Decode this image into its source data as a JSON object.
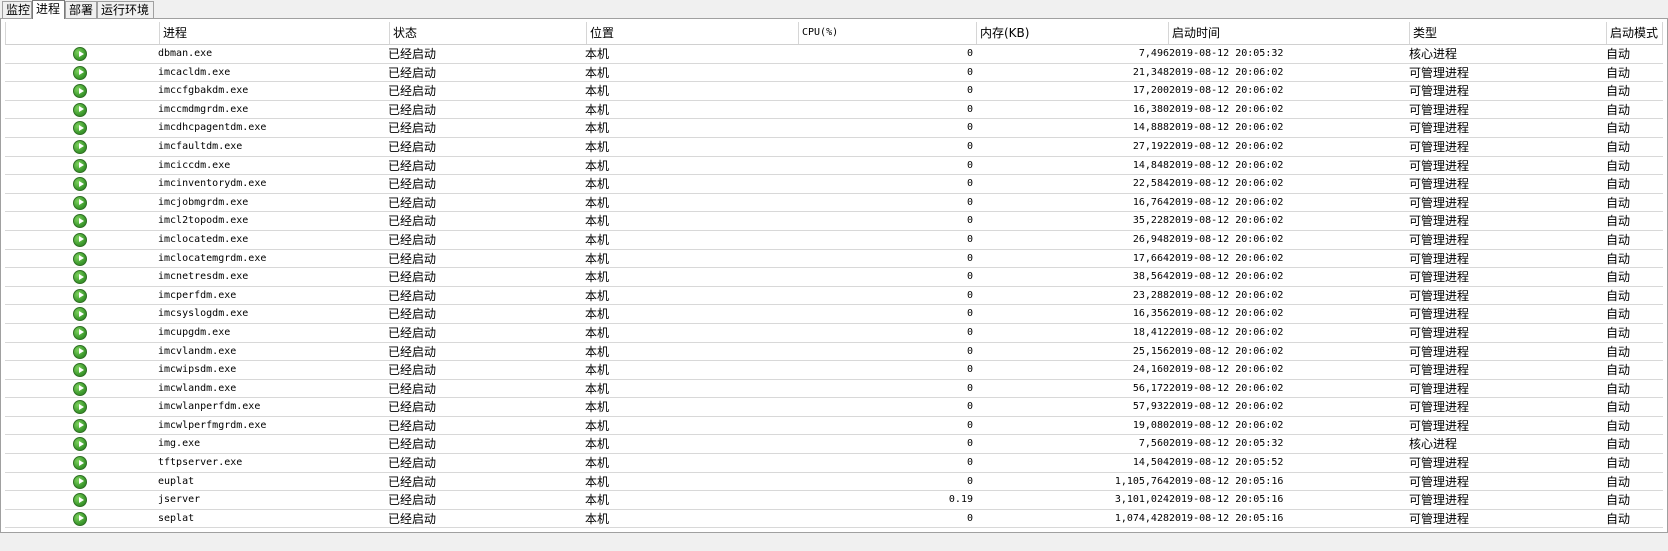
{
  "tabs": [
    "监控",
    "进程",
    "部署",
    "运行环境"
  ],
  "active_tab": "进程",
  "columns": [
    "进程",
    "状态",
    "位置",
    "CPU(%)",
    "内存(KB)",
    "启动时间",
    "类型",
    "启动模式"
  ],
  "rows": [
    {
      "icon": "running-icon",
      "name": "dbman.exe",
      "status": "已经启动",
      "location": "本机",
      "cpu": "0",
      "memory": "7,496",
      "start": "2019-08-12 20:05:32",
      "type": "核心进程",
      "mode": "自动"
    },
    {
      "icon": "running-icon",
      "name": "imcacldm.exe",
      "status": "已经启动",
      "location": "本机",
      "cpu": "0",
      "memory": "21,348",
      "start": "2019-08-12 20:06:02",
      "type": "可管理进程",
      "mode": "自动"
    },
    {
      "icon": "running-icon",
      "name": "imccfgbakdm.exe",
      "status": "已经启动",
      "location": "本机",
      "cpu": "0",
      "memory": "17,200",
      "start": "2019-08-12 20:06:02",
      "type": "可管理进程",
      "mode": "自动"
    },
    {
      "icon": "running-icon",
      "name": "imccmdmgrdm.exe",
      "status": "已经启动",
      "location": "本机",
      "cpu": "0",
      "memory": "16,380",
      "start": "2019-08-12 20:06:02",
      "type": "可管理进程",
      "mode": "自动"
    },
    {
      "icon": "running-icon",
      "name": "imcdhcpagentdm.exe",
      "status": "已经启动",
      "location": "本机",
      "cpu": "0",
      "memory": "14,888",
      "start": "2019-08-12 20:06:02",
      "type": "可管理进程",
      "mode": "自动"
    },
    {
      "icon": "running-icon",
      "name": "imcfaultdm.exe",
      "status": "已经启动",
      "location": "本机",
      "cpu": "0",
      "memory": "27,192",
      "start": "2019-08-12 20:06:02",
      "type": "可管理进程",
      "mode": "自动"
    },
    {
      "icon": "running-icon",
      "name": "imciccdm.exe",
      "status": "已经启动",
      "location": "本机",
      "cpu": "0",
      "memory": "14,848",
      "start": "2019-08-12 20:06:02",
      "type": "可管理进程",
      "mode": "自动"
    },
    {
      "icon": "running-icon",
      "name": "imcinventorydm.exe",
      "status": "已经启动",
      "location": "本机",
      "cpu": "0",
      "memory": "22,584",
      "start": "2019-08-12 20:06:02",
      "type": "可管理进程",
      "mode": "自动"
    },
    {
      "icon": "running-icon",
      "name": "imcjobmgrdm.exe",
      "status": "已经启动",
      "location": "本机",
      "cpu": "0",
      "memory": "16,764",
      "start": "2019-08-12 20:06:02",
      "type": "可管理进程",
      "mode": "自动"
    },
    {
      "icon": "running-icon",
      "name": "imcl2topodm.exe",
      "status": "已经启动",
      "location": "本机",
      "cpu": "0",
      "memory": "35,228",
      "start": "2019-08-12 20:06:02",
      "type": "可管理进程",
      "mode": "自动"
    },
    {
      "icon": "running-icon",
      "name": "imclocatedm.exe",
      "status": "已经启动",
      "location": "本机",
      "cpu": "0",
      "memory": "26,948",
      "start": "2019-08-12 20:06:02",
      "type": "可管理进程",
      "mode": "自动"
    },
    {
      "icon": "running-icon",
      "name": "imclocatemgrdm.exe",
      "status": "已经启动",
      "location": "本机",
      "cpu": "0",
      "memory": "17,664",
      "start": "2019-08-12 20:06:02",
      "type": "可管理进程",
      "mode": "自动"
    },
    {
      "icon": "running-icon",
      "name": "imcnetresdm.exe",
      "status": "已经启动",
      "location": "本机",
      "cpu": "0",
      "memory": "38,564",
      "start": "2019-08-12 20:06:02",
      "type": "可管理进程",
      "mode": "自动"
    },
    {
      "icon": "running-icon",
      "name": "imcperfdm.exe",
      "status": "已经启动",
      "location": "本机",
      "cpu": "0",
      "memory": "23,288",
      "start": "2019-08-12 20:06:02",
      "type": "可管理进程",
      "mode": "自动"
    },
    {
      "icon": "running-icon",
      "name": "imcsyslogdm.exe",
      "status": "已经启动",
      "location": "本机",
      "cpu": "0",
      "memory": "16,356",
      "start": "2019-08-12 20:06:02",
      "type": "可管理进程",
      "mode": "自动"
    },
    {
      "icon": "running-icon",
      "name": "imcupgdm.exe",
      "status": "已经启动",
      "location": "本机",
      "cpu": "0",
      "memory": "18,412",
      "start": "2019-08-12 20:06:02",
      "type": "可管理进程",
      "mode": "自动"
    },
    {
      "icon": "running-icon",
      "name": "imcvlandm.exe",
      "status": "已经启动",
      "location": "本机",
      "cpu": "0",
      "memory": "25,156",
      "start": "2019-08-12 20:06:02",
      "type": "可管理进程",
      "mode": "自动"
    },
    {
      "icon": "running-icon",
      "name": "imcwipsdm.exe",
      "status": "已经启动",
      "location": "本机",
      "cpu": "0",
      "memory": "24,160",
      "start": "2019-08-12 20:06:02",
      "type": "可管理进程",
      "mode": "自动"
    },
    {
      "icon": "running-icon",
      "name": "imcwlandm.exe",
      "status": "已经启动",
      "location": "本机",
      "cpu": "0",
      "memory": "56,172",
      "start": "2019-08-12 20:06:02",
      "type": "可管理进程",
      "mode": "自动"
    },
    {
      "icon": "running-icon",
      "name": "imcwlanperfdm.exe",
      "status": "已经启动",
      "location": "本机",
      "cpu": "0",
      "memory": "57,932",
      "start": "2019-08-12 20:06:02",
      "type": "可管理进程",
      "mode": "自动"
    },
    {
      "icon": "running-icon",
      "name": "imcwlperfmgrdm.exe",
      "status": "已经启动",
      "location": "本机",
      "cpu": "0",
      "memory": "19,080",
      "start": "2019-08-12 20:06:02",
      "type": "可管理进程",
      "mode": "自动"
    },
    {
      "icon": "running-icon",
      "name": "img.exe",
      "status": "已经启动",
      "location": "本机",
      "cpu": "0",
      "memory": "7,560",
      "start": "2019-08-12 20:05:32",
      "type": "核心进程",
      "mode": "自动"
    },
    {
      "icon": "running-icon",
      "name": "tftpserver.exe",
      "status": "已经启动",
      "location": "本机",
      "cpu": "0",
      "memory": "14,504",
      "start": "2019-08-12 20:05:52",
      "type": "可管理进程",
      "mode": "自动"
    },
    {
      "icon": "running-icon",
      "name": "euplat",
      "status": "已经启动",
      "location": "本机",
      "cpu": "0",
      "memory": "1,105,764",
      "start": "2019-08-12 20:05:16",
      "type": "可管理进程",
      "mode": "自动"
    },
    {
      "icon": "running-icon",
      "name": "jserver",
      "status": "已经启动",
      "location": "本机",
      "cpu": "0.19",
      "memory": "3,101,024",
      "start": "2019-08-12 20:05:16",
      "type": "可管理进程",
      "mode": "自动"
    },
    {
      "icon": "running-icon",
      "name": "seplat",
      "status": "已经启动",
      "location": "本机",
      "cpu": "0",
      "memory": "1,074,428",
      "start": "2019-08-12 20:05:16",
      "type": "可管理进程",
      "mode": "自动"
    }
  ]
}
